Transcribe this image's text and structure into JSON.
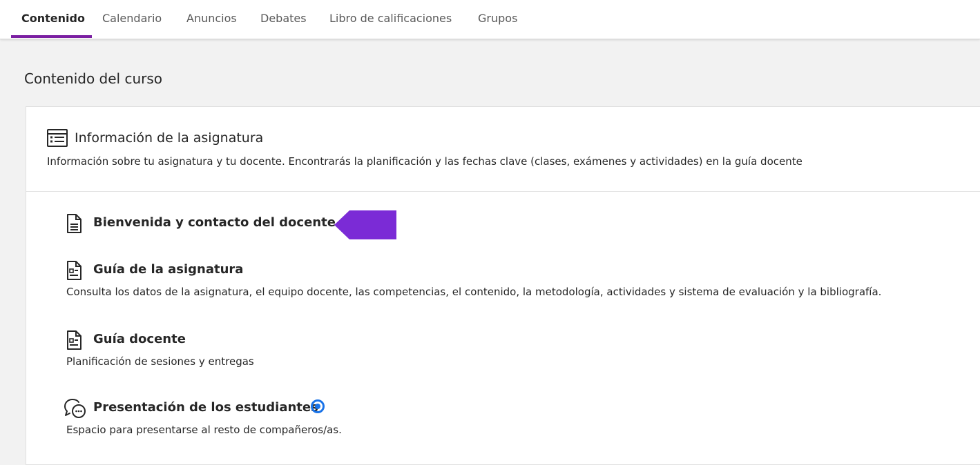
{
  "tabs": [
    {
      "label": "Contenido",
      "active": true
    },
    {
      "label": "Calendario"
    },
    {
      "label": "Anuncios"
    },
    {
      "label": "Debates"
    },
    {
      "label": "Libro de calificaciones"
    },
    {
      "label": "Grupos"
    }
  ],
  "page_title": "Contenido del curso",
  "folder": {
    "title": "Información de la asignatura",
    "description": "Información sobre tu asignatura y tu docente. Encontrarás la planificación y las fechas clave (clases, exámenes y actividades) en la guía docente",
    "icon": "syllabus-icon"
  },
  "items": [
    {
      "title": "Bienvenida y contacto del docente",
      "description": "",
      "icon": "document-icon"
    },
    {
      "title": "Guía de la asignatura",
      "description": "Consulta los datos de la asignatura, el equipo docente, las competencias, el contenido, la metodología, actividades y sistema de evaluación y la bibliografía.",
      "icon": "document-icon"
    },
    {
      "title": "Guía docente",
      "description": "Planificación de sesiones y entregas",
      "icon": "document-icon"
    },
    {
      "title": "Presentación de los estudiantes",
      "description": "Espacio para presentarse al resto de compañeros/as.",
      "icon": "discussion-icon"
    }
  ],
  "colors": {
    "accent": "#7b1fa2",
    "annotation_arrow": "#7b2bd6",
    "badge_blue": "#1a73e8"
  }
}
